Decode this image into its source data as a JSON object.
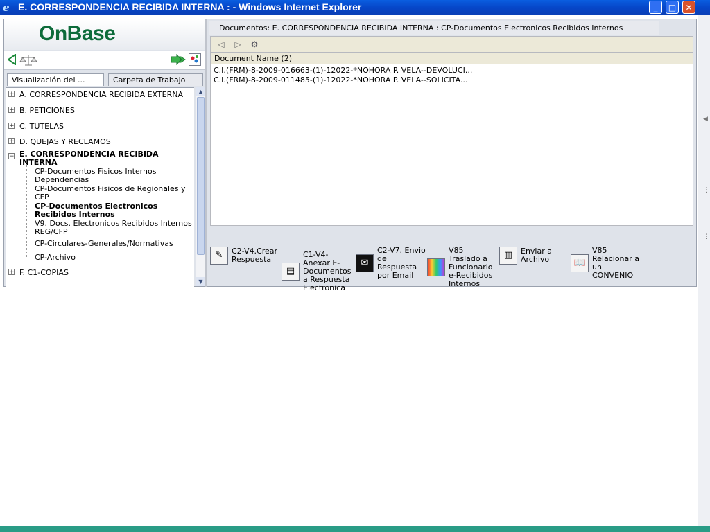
{
  "window": {
    "title": "E. CORRESPONDENCIA RECIBIDA INTERNA : - Windows Internet Explorer",
    "minimize": "_",
    "maximize": "□",
    "close": "✕"
  },
  "left": {
    "logo": "OnBase",
    "tabs": [
      {
        "label": "Visualización del ..."
      },
      {
        "label": "Carpeta de Trabajo"
      }
    ],
    "tree": [
      {
        "label": "A. CORRESPONDENCIA RECIBIDA EXTERNA",
        "expander": "+"
      },
      {
        "label": "B. PETICIONES",
        "expander": "+"
      },
      {
        "label": "C. TUTELAS",
        "expander": "+"
      },
      {
        "label": "D. QUEJAS Y RECLAMOS",
        "expander": "+"
      },
      {
        "label": "E. CORRESPONDENCIA RECIBIDA INTERNA",
        "expander": "−"
      },
      {
        "label": "F. C1-COPIAS",
        "expander": "+"
      }
    ],
    "children": [
      {
        "label": "CP-Documentos Fisicos Internos Dependencias"
      },
      {
        "label": "CP-Documentos Fisicos de Regionales y CFP"
      },
      {
        "label": "CP-Documentos Electronicos Recibidos Internos"
      },
      {
        "label": "V9. Docs. Electronicos Recibidos Internos REG/CFP"
      },
      {
        "label": "CP-Circulares-Generales/Normativas"
      },
      {
        "label": "CP-Archivo"
      }
    ]
  },
  "right": {
    "tab": "Documentos: E. CORRESPONDENCIA RECIBIDA INTERNA : CP-Documentos Electronicos Recibidos Internos",
    "column_header": "Document Name (2)",
    "rows": [
      {
        "name": "C.I.(FRM)-8-2009-016663-(1)-12022-*NOHORA P. VELA--DEVOLUCI..."
      },
      {
        "name": "C.I.(FRM)-8-2009-011485-(1)-12022-*NOHORA P. VELA--SOLICITA..."
      }
    ],
    "actions": [
      {
        "label": "C2-V4.Crear Respuesta",
        "icon": "pencil-icon"
      },
      {
        "label": "C1-V4-Anexar E-Documentos a Respuesta Electronica",
        "icon": "attach-icon"
      },
      {
        "label": "C2-V7. Envio de Respuesta por Email",
        "icon": "email-icon"
      },
      {
        "label": "V85 Traslado a Funcionario e-Recibidos Internos",
        "icon": "transfer-icon"
      },
      {
        "label": "Enviar a Archivo",
        "icon": "archive-icon"
      },
      {
        "label": "V85 Relacionar a un CONVENIO",
        "icon": "book-icon"
      }
    ]
  }
}
